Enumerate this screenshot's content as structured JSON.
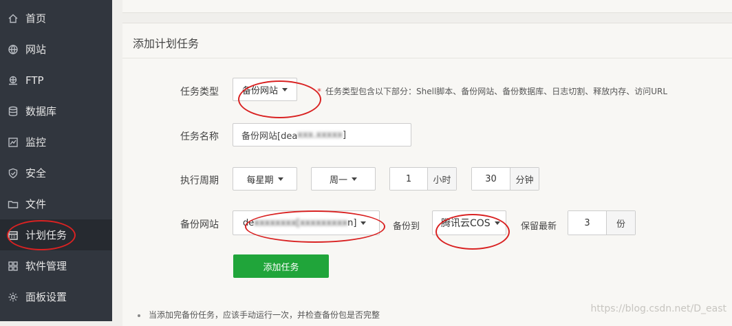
{
  "sidebar": {
    "items": [
      {
        "label": "首页",
        "icon": "home-icon"
      },
      {
        "label": "网站",
        "icon": "globe-icon"
      },
      {
        "label": "FTP",
        "icon": "ftp-icon"
      },
      {
        "label": "数据库",
        "icon": "database-icon"
      },
      {
        "label": "监控",
        "icon": "monitor-icon"
      },
      {
        "label": "安全",
        "icon": "shield-icon"
      },
      {
        "label": "文件",
        "icon": "folder-icon"
      },
      {
        "label": "计划任务",
        "icon": "calendar-icon",
        "active": true
      },
      {
        "label": "软件管理",
        "icon": "grid-icon"
      },
      {
        "label": "面板设置",
        "icon": "gear-icon"
      }
    ]
  },
  "panel": {
    "title": "添加计划任务",
    "task_type": {
      "label": "任务类型",
      "value": "备份网站",
      "hint_star": "*",
      "hint": "任务类型包含以下部分：Shell脚本、备份网站、备份数据库、日志切割、释放内存、访问URL"
    },
    "task_name": {
      "label": "任务名称",
      "value_prefix": "备份网站[dea",
      "value_blurred": "xxx.xxxxx",
      "value_suffix": "]"
    },
    "period": {
      "label": "执行周期",
      "frequency": "每星期",
      "weekday": "周一",
      "hour_value": "1",
      "hour_unit": "小时",
      "minute_value": "30",
      "minute_unit": "分钟"
    },
    "backup": {
      "label": "备份网站",
      "site_prefix": "de",
      "site_blurred": "xxxxxxxx[xxxxxxxxx",
      "site_suffix": "n]",
      "to_label": "备份到",
      "destination": "腾讯云COS",
      "keep_label": "保留最新",
      "keep_value": "3",
      "keep_unit": "份"
    },
    "submit_label": "添加任务",
    "note": "当添加完备份任务，应该手动运行一次，并检查备份包是否完整"
  },
  "watermark": "https://blog.csdn.net/D_east",
  "colors": {
    "sidebar_bg": "#31363e",
    "primary_button": "#20a53a",
    "annotation_red": "#d92222"
  }
}
